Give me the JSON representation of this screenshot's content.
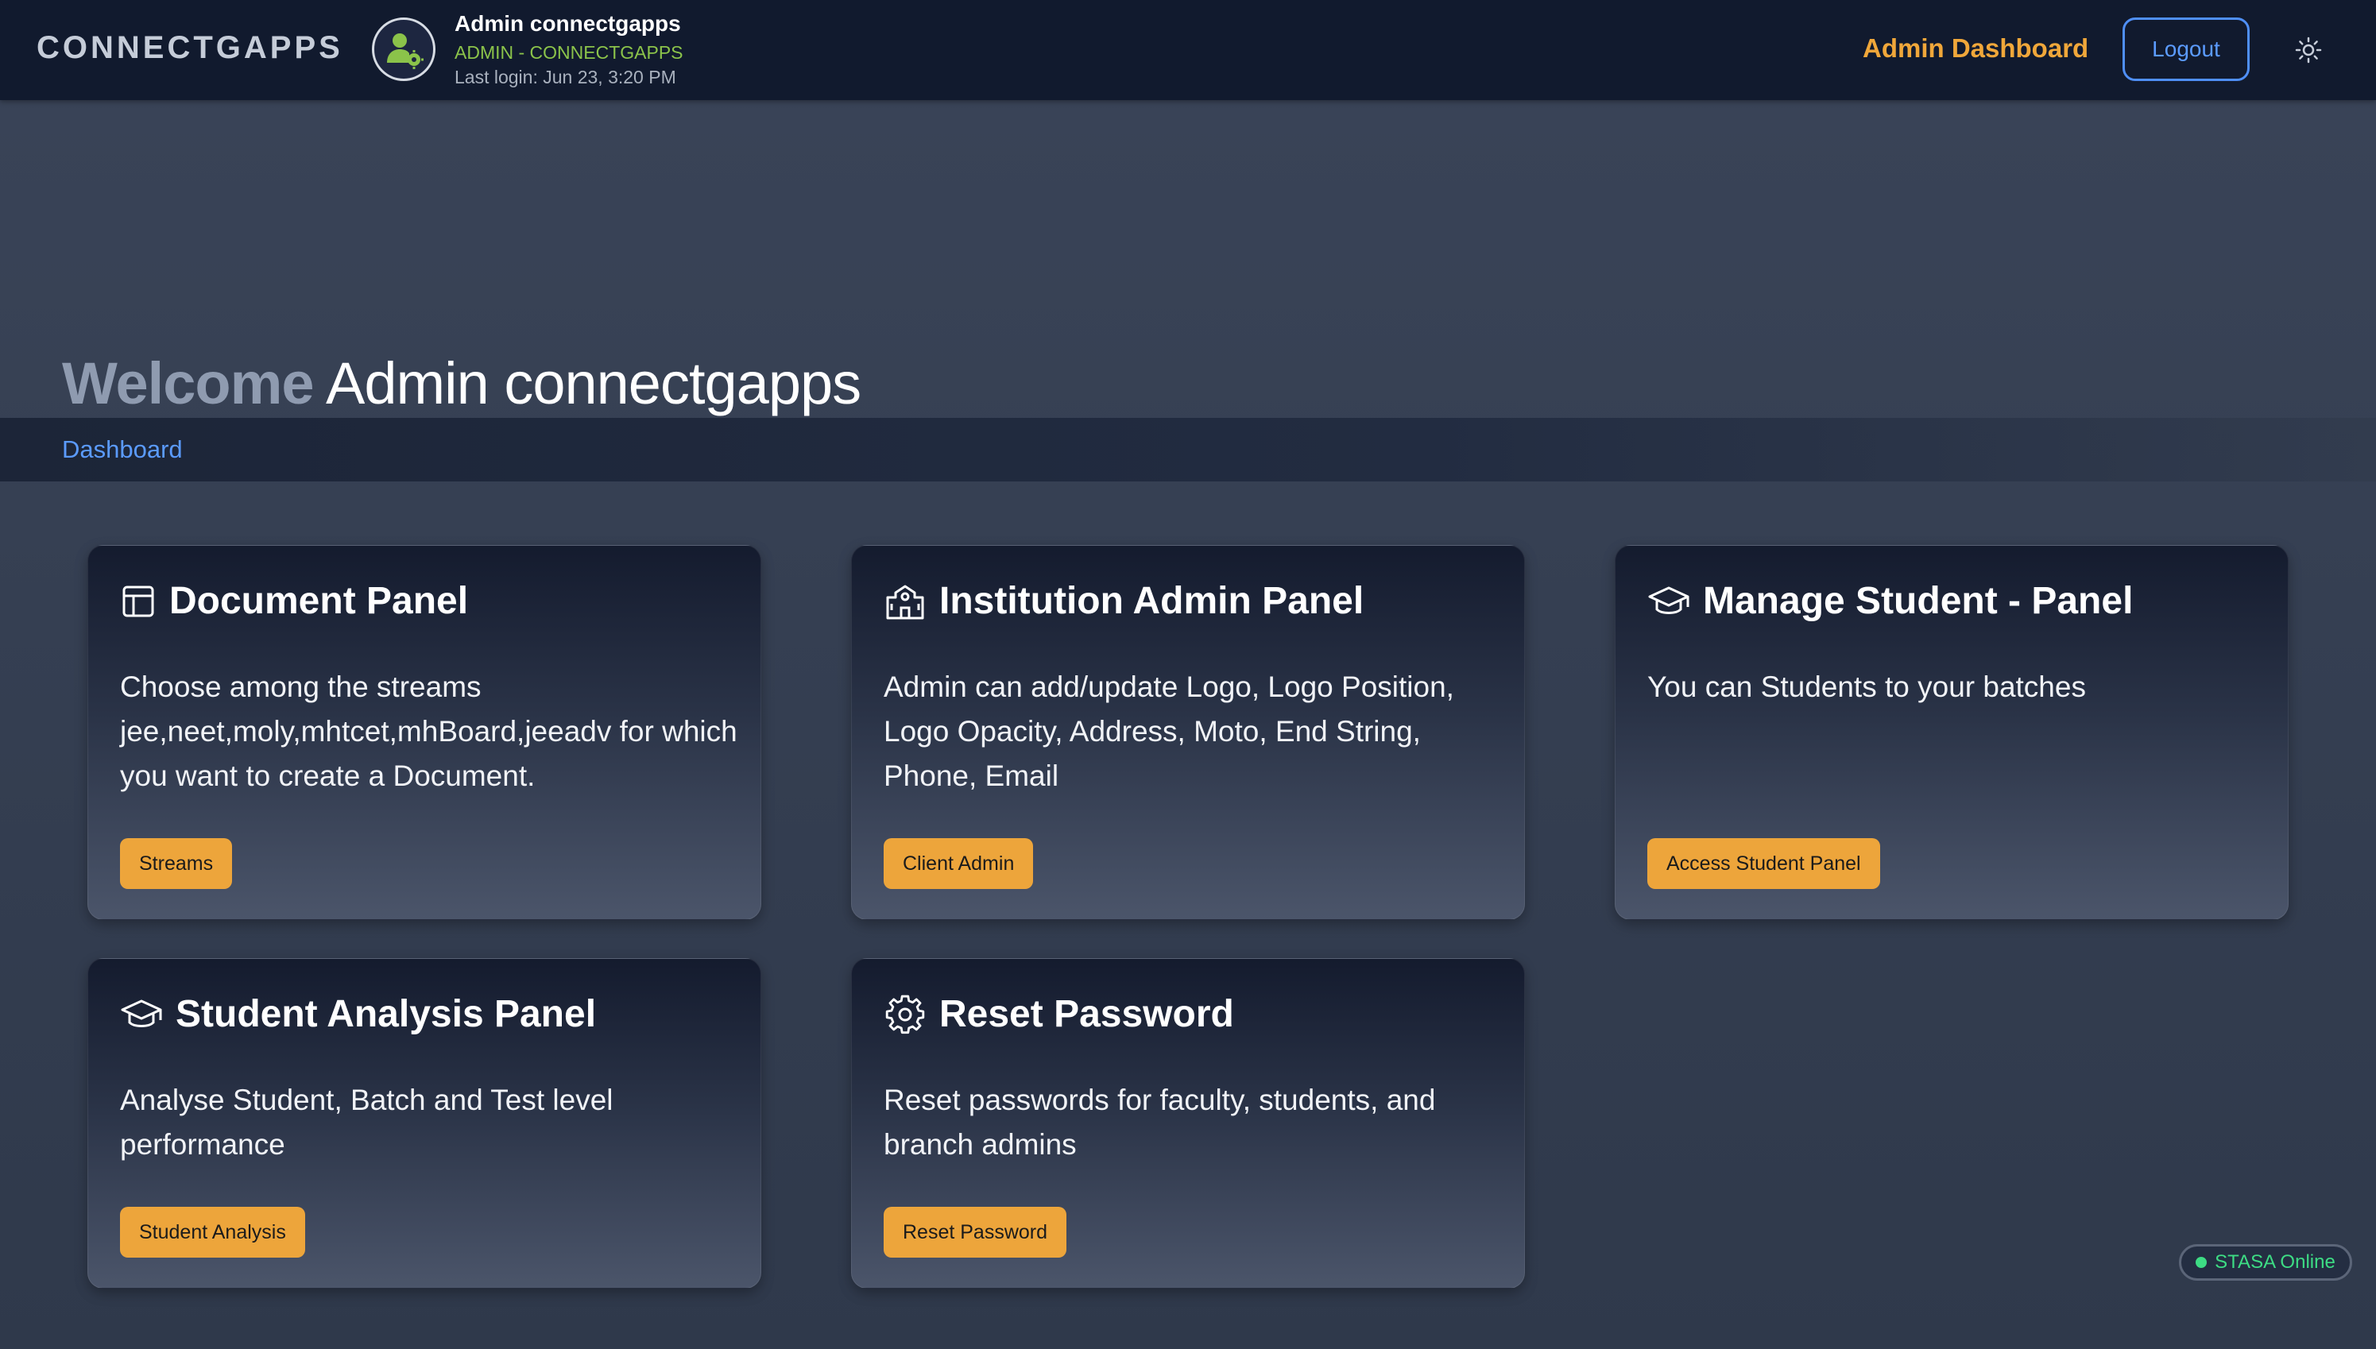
{
  "header": {
    "brand": "CONNECTGAPPS",
    "user_name": "Admin connectgapps",
    "user_role": "ADMIN - CONNECTGAPPS",
    "last_login": "Last login: Jun 23, 3:20 PM",
    "nav_dashboard": "Admin Dashboard",
    "logout_label": "Logout",
    "theme_icon": "sun-icon",
    "avatar_icon": "user-gear-icon"
  },
  "welcome": {
    "prefix": "Welcome",
    "name": "Admin connectgapps"
  },
  "breadcrumb": {
    "current": "Dashboard"
  },
  "cards": [
    {
      "icon": "layout-icon",
      "title": "Document Panel",
      "description": "Choose among the streams jee,neet,moly,mhtcet,mhBoard,jeeadv for which you want to create a Document.",
      "button": "Streams"
    },
    {
      "icon": "school-icon",
      "title": "Institution Admin Panel",
      "description": "Admin can add/update Logo, Logo Position, Logo Opacity, Address, Moto, End String, Phone, Email",
      "button": "Client Admin"
    },
    {
      "icon": "graduation-cap-icon",
      "title": "Manage Student - Panel",
      "description": "You can Students to your batches",
      "button": "Access Student Panel"
    },
    {
      "icon": "graduation-cap-icon",
      "title": "Student Analysis Panel",
      "description": "Analyse Student, Batch and Test level performance",
      "button": "Student Analysis"
    },
    {
      "icon": "gear-icon",
      "title": "Reset Password",
      "description": "Reset passwords for faculty, students, and branch admins",
      "button": "Reset Password"
    }
  ],
  "status": {
    "label": "STASA Online"
  },
  "colors": {
    "accent": "#eda53b",
    "link": "#5b9bff",
    "role": "#8bc34a",
    "online": "#3ddc84",
    "header_bg": "#111a2e"
  }
}
